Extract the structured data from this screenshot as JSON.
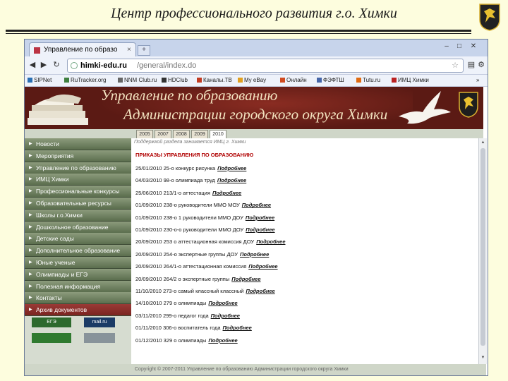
{
  "slide": {
    "title": "Центр профессионального развития г.о. Химки"
  },
  "browser": {
    "tab_title": "Управление по образо",
    "tab_close": "×",
    "new_tab": "+",
    "url_host": "himki-edu.ru",
    "url_path": "/general/index.do",
    "window_controls": [
      "–",
      "□",
      "✕"
    ],
    "bookmarks": [
      {
        "label": "SIPNet",
        "color": "#2a6fb3"
      },
      {
        "label": "RuTracker.org",
        "color": "#3f7f3f"
      },
      {
        "label": "NNM Club.ru",
        "color": "#666666"
      },
      {
        "label": "HDClub",
        "color": "#333333"
      },
      {
        "label": "Каналы.ТВ",
        "color": "#c23b22"
      },
      {
        "label": "My eBay",
        "color": "#e0a020"
      },
      {
        "label": "Онлайн",
        "color": "#d04b20"
      },
      {
        "label": "ФЭФТШ",
        "color": "#4666a8"
      },
      {
        "label": "Tutu.ru",
        "color": "#e06a10"
      },
      {
        "label": "ИМЦ Химки",
        "color": "#bb2222"
      }
    ]
  },
  "banner": {
    "line1": "Управление по образованию",
    "line2": "Администрации городского округа Химки"
  },
  "years": [
    "2005",
    "2007",
    "2008",
    "2009",
    "2010"
  ],
  "selected_year": "2010",
  "sidebar": {
    "items": [
      "Новости",
      "Мероприятия",
      "Управление по образованию",
      "ИМЦ Химки",
      "Профессиональные конкурсы",
      "Образовательные ресурсы",
      "Школы г.о.Химки",
      "Дошкольное образование",
      "Детские сады",
      "Дополнительное образование",
      "Юные ученые",
      "Олимпиады и ЕГЭ",
      "Полезная информация",
      "Контакты",
      "Архив документов"
    ],
    "active_index": 14,
    "badges": [
      "ЕГЭ",
      "mail.ru",
      "",
      ""
    ]
  },
  "content": {
    "note": "Поддержкой раздела занимается ИМЦ г. Химки",
    "title": "ПРИКАЗЫ УПРАВЛЕНИЯ ПО ОБРАЗОВАНИЮ",
    "more_label": "Подробнее",
    "orders": [
      "25/01/2010 25-о конкурс рисунка",
      "04/03/2010 98-о олимпиада труд",
      "25/06/2010 213/1-о аттестация",
      "01/09/2010 238-о руководители ММО МОУ",
      "01/09/2010 238-о 1 руководители ММО ДОУ",
      "01/09/2010 230-о-о руководители ММО ДОУ",
      "20/09/2010 253 о аттестационная комиссия ДОУ",
      "20/09/2010 254-о экспертные группы ДОУ",
      "20/09/2010 264/1-о аттестационная комиссия",
      "20/09/2010 264/2 о экспертные группы",
      "11/10/2010 273-о самый классный классный",
      "14/10/2010 279 о олимпиады",
      "03/11/2010 299-о педагог года",
      "01/11/2010 306-о воспитатель года",
      "01/12/2010 329 о олимпиады"
    ]
  },
  "footer": {
    "text": "Copyright © 2007-2011 Управление по образованию Администрации городского округа Химки"
  },
  "colors": {
    "slide_bg": "#fdfdde",
    "banner_bg": "#5b1a14",
    "sidebar_item": "#6f7f60",
    "sidebar_active": "#8a2e2a",
    "content_title": "#b00000"
  }
}
